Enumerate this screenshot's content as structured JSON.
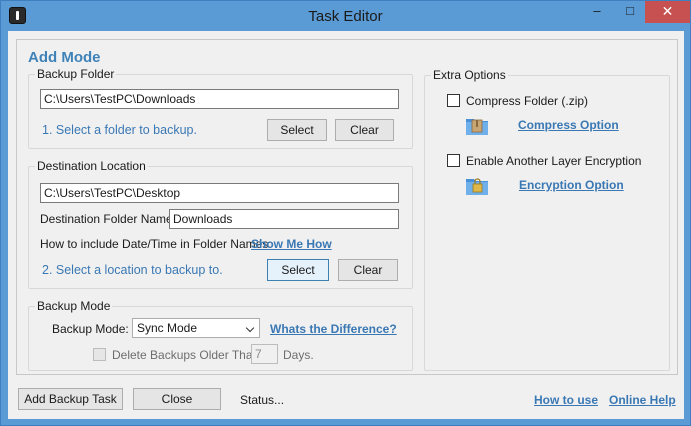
{
  "window": {
    "title": "Task Editor",
    "minimize_glyph": "–",
    "maximize_glyph": "□",
    "close_glyph": "✕"
  },
  "mode_title": "Add Mode",
  "backup_folder": {
    "legend": "Backup Folder",
    "path": "C:\\Users\\TestPC\\Downloads",
    "hint": "1. Select a folder to backup.",
    "select_label": "Select",
    "clear_label": "Clear"
  },
  "destination": {
    "legend": "Destination Location",
    "path": "C:\\Users\\TestPC\\Desktop",
    "folder_name_label": "Destination Folder Name:",
    "folder_name_value": "Downloads",
    "datetime_label": "How to include Date/Time in Folder Names:",
    "show_me_how": "Show Me How",
    "hint": "2. Select a location to backup to.",
    "select_label": "Select",
    "clear_label": "Clear"
  },
  "backup_mode": {
    "legend": "Backup Mode",
    "mode_label": "Backup Mode:",
    "mode_value": "Sync Mode",
    "difference_link": "Whats the Difference?",
    "delete_label": "Delete Backups Older Than:",
    "days_value": "7",
    "days_label": "Days."
  },
  "extra_options": {
    "legend": "Extra Options",
    "compress_label": "Compress Folder (.zip)",
    "compress_link": "Compress Option",
    "encryption_label": "Enable Another Layer Encryption",
    "encryption_link": "Encryption Option"
  },
  "footer": {
    "add_task_label": "Add Backup Task",
    "close_label": "Close",
    "status": "Status...",
    "how_to_use": "How to use",
    "online_help": "Online Help"
  },
  "colors": {
    "titlebar": "#5b9bd5",
    "accent": "#3a78b4",
    "close_button": "#c75050"
  },
  "icons": {
    "app": "app-icon",
    "compress": "zip-folder-icon",
    "encryption": "lock-folder-icon"
  }
}
